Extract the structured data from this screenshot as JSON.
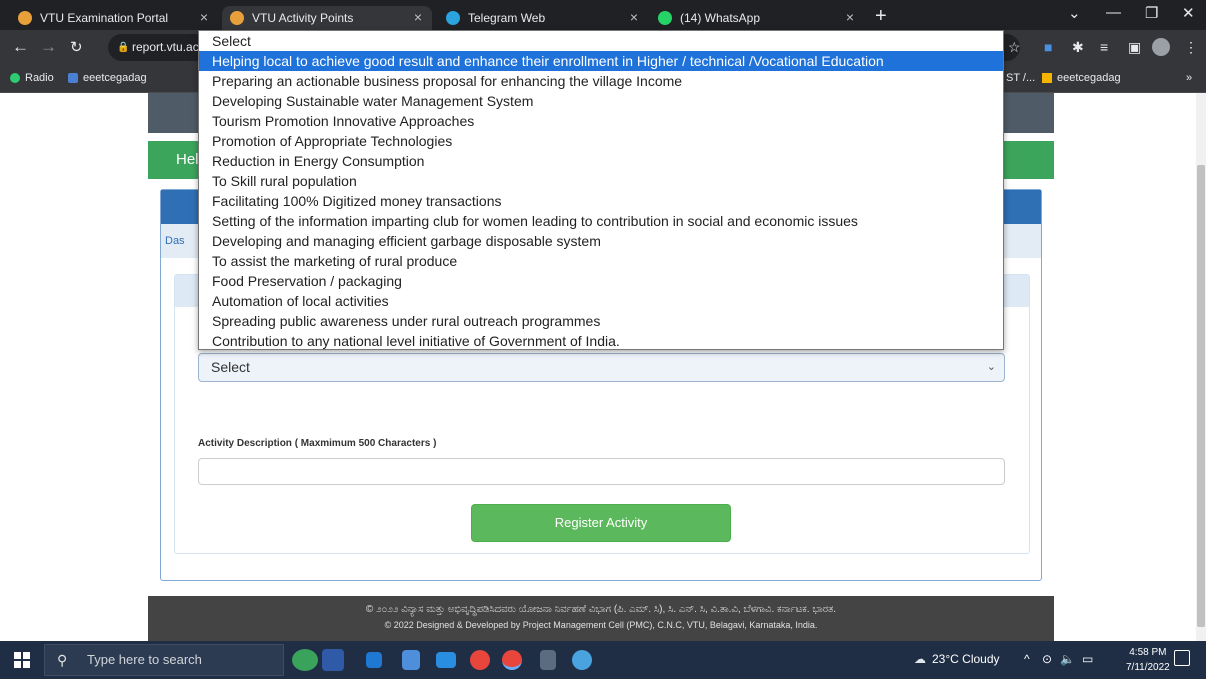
{
  "browser": {
    "tabs": [
      {
        "title": "VTU Examination Portal",
        "icon": "vtu-logo-icon",
        "color": "#e8a13a",
        "active": false
      },
      {
        "title": "VTU Activity Points",
        "icon": "vtu-logo-icon",
        "color": "#e8a13a",
        "active": true
      },
      {
        "title": "Telegram Web",
        "icon": "telegram-icon",
        "color": "#2aa3df",
        "active": false
      },
      {
        "title": "(14) WhatsApp",
        "icon": "whatsapp-icon",
        "color": "#25d366",
        "active": false
      }
    ],
    "close_glyph": "×",
    "new_tab_glyph": "+",
    "url": "report.vtu.ac",
    "bookmarks": [
      {
        "label": "Radio",
        "color": "#2ecc71"
      },
      {
        "label": "eeetcegadag",
        "color": "#4a7fd4"
      }
    ],
    "bookmark_right_fragment": "ST /...",
    "bookmark_right": "eeetcegadag",
    "bookmark_more": "»"
  },
  "page": {
    "banner_fragment": "Hel",
    "breadcrumb_fragment": "Das",
    "activity_select": {
      "value": "Select",
      "options": [
        "Select",
        "Helping local to achieve good result and enhance their enrollment in Higher / technical /Vocational Education",
        "Preparing an actionable business proposal for enhancing the village Income",
        "Developing Sustainable water Management System",
        "Tourism Promotion Innovative Approaches",
        "Promotion of Appropriate Technologies",
        "Reduction in Energy Consumption",
        "To Skill rural population",
        "Facilitating 100% Digitized money transactions",
        "Setting of the information imparting club for women leading to contribution in social and economic issues",
        "Developing and managing efficient garbage disposable system",
        "To assist the marketing of rural produce",
        "Food Preservation / packaging",
        "Automation of local activities",
        "Spreading public awareness under rural outreach programmes",
        "Contribution to any national level initiative of Government of India."
      ],
      "highlighted_index": 1
    },
    "description_label": "Activity Description ( Maxmimum 500 Characters )",
    "register_button": "Register Activity",
    "footer": {
      "line1": "© ೨೦೨೨ ವಿನ್ಯಾಸ ಮತ್ತು ಅಭಿವೃದ್ಧಿಪಡಿಸಿದವರು ಯೋಜನಾ ನಿರ್ವಹಣೆ ವಿಭಾಗ (ಪಿ. ಎಮ್. ಸಿ), ಸಿ. ಎನ್. ಸಿ, ವಿ.ತಾ.ವಿ, ಬೆಳಗಾವಿ. ಕರ್ನಾಟಕ. ಭಾರತ.",
      "line2": "© 2022 Designed & Developed by Project Management Cell (PMC), C.N.C, VTU, Belagavi, Karnataka, India."
    }
  },
  "taskbar": {
    "search_placeholder": "Type here to search",
    "weather": "23°C  Cloudy",
    "time": "4:58 PM",
    "date": "7/11/2022"
  }
}
